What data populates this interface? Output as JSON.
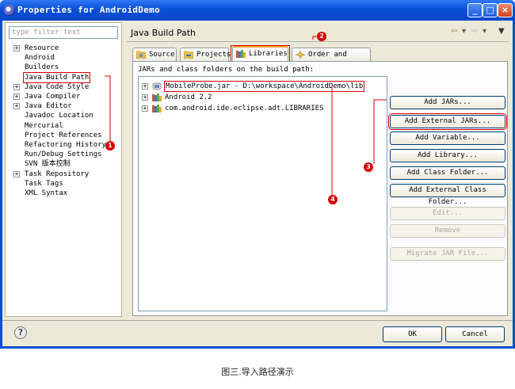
{
  "window": {
    "title": "Properties for AndroidDemo"
  },
  "filter": {
    "placeholder": "type filter text"
  },
  "tree": [
    {
      "label": "Resource",
      "expandable": true
    },
    {
      "label": "Android",
      "expandable": false
    },
    {
      "label": "Builders",
      "expandable": false
    },
    {
      "label": "Java Build Path",
      "expandable": false,
      "selected": true
    },
    {
      "label": "Java Code Style",
      "expandable": true
    },
    {
      "label": "Java Compiler",
      "expandable": true
    },
    {
      "label": "Java Editor",
      "expandable": true
    },
    {
      "label": "Javadoc Location",
      "expandable": false
    },
    {
      "label": "Mercurial",
      "expandable": false
    },
    {
      "label": "Project References",
      "expandable": false
    },
    {
      "label": "Refactoring History",
      "expandable": false
    },
    {
      "label": "Run/Debug Settings",
      "expandable": false
    },
    {
      "label": "SVN 版本控制",
      "expandable": false
    },
    {
      "label": "Task Repository",
      "expandable": true
    },
    {
      "label": "Task Tags",
      "expandable": false
    },
    {
      "label": "XML Syntax",
      "expandable": false
    }
  ],
  "page": {
    "title": "Java Build Path"
  },
  "tabs": [
    {
      "label": "Source"
    },
    {
      "label": "Projects"
    },
    {
      "label": "Libraries",
      "active": true
    },
    {
      "label": "Order and Export"
    }
  ],
  "libraries": {
    "label": "JARs and class folders on the build path:",
    "entries": [
      {
        "label": "MobileProbe.jar - D:\\workspace\\AndroidDemo\\lib"
      },
      {
        "label": "Android 2.2"
      },
      {
        "label": "com.android.ide.eclipse.adt.LIBRARIES"
      }
    ]
  },
  "buttons": {
    "add_jars": "Add JARs...",
    "add_external_jars": "Add External JARs...",
    "add_variable": "Add Variable...",
    "add_library": "Add Library...",
    "add_class_folder": "Add Class Folder...",
    "add_external_class_folder": "Add External Class Folder...",
    "edit": "Edit...",
    "remove": "Remove",
    "migrate": "Migrate JAR File..."
  },
  "dialog": {
    "ok": "OK",
    "cancel": "Cancel",
    "help": "?"
  },
  "markers": [
    "1",
    "2",
    "3",
    "4"
  ],
  "caption": "图三.导入路径演示",
  "colors": {
    "annotation": "#d60000",
    "titlebar": "#0a4fd6",
    "client": "#ece9d8"
  },
  "icons": [
    "eclipse-icon",
    "folder-source-icon",
    "projects-icon",
    "libraries-icon",
    "order-export-icon",
    "jar-icon",
    "library-icon",
    "help-icon"
  ]
}
